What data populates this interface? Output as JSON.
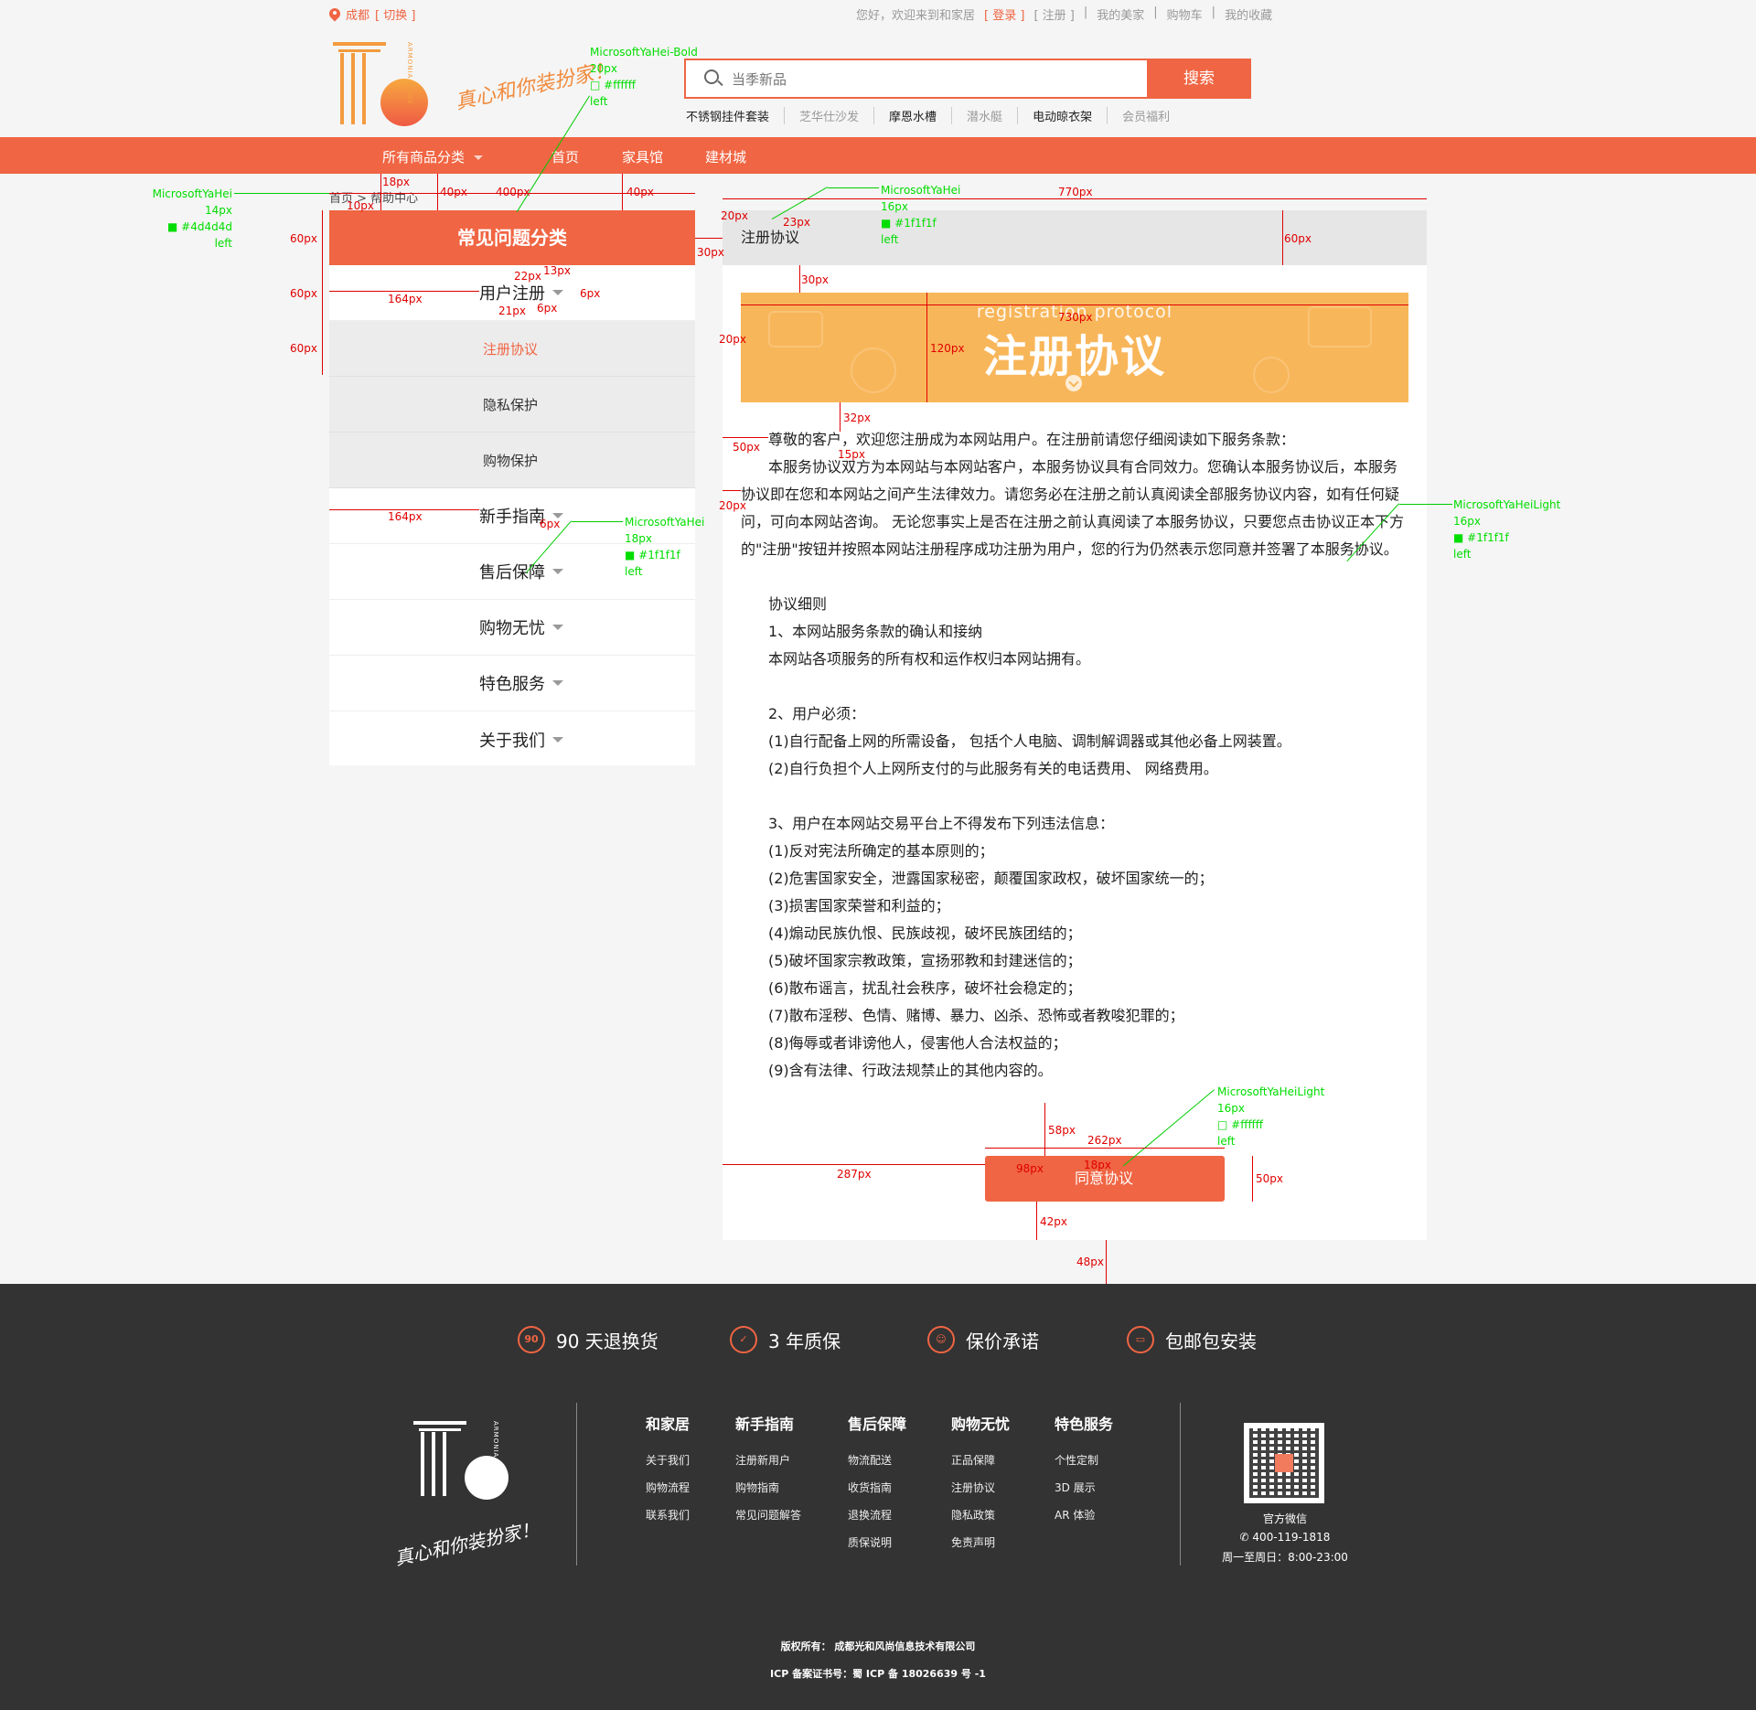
{
  "topbar": {
    "city": "成都",
    "switch": "[ 切换 ]",
    "welcome": "您好，欢迎来到和家居",
    "login": "[ 登录 ]",
    "register": "[ 注册 ]",
    "my_home": "我的美家",
    "cart": "购物车",
    "favorites": "我的收藏",
    "sep": "|"
  },
  "header": {
    "logo_side_text": "ARMONIA HOME",
    "slogan": "真心和你装扮家！",
    "search_placeholder": "当季新品",
    "search_button": "搜索",
    "hotwords": [
      "不锈钢挂件套装",
      "芝华仕沙发",
      "摩恩水槽",
      "潜水艇",
      "电动晾衣架",
      "会员福利"
    ]
  },
  "nav": {
    "all_categories": "所有商品分类",
    "items": [
      "首页",
      "家具馆",
      "建材城"
    ]
  },
  "breadcrumb": "首页 > 帮助中心",
  "sidebar": {
    "title": "常见问题分类",
    "group1": "用户注册",
    "sub": [
      "注册协议",
      "隐私保护",
      "购物保护"
    ],
    "groups": [
      "新手指南",
      "售后保障",
      "购物无忧",
      "特色服务",
      "关于我们"
    ]
  },
  "main": {
    "title": "注册协议",
    "banner_en": "registration protocol",
    "banner_cn": "注册协议",
    "paragraphs": [
      "尊敬的客户，欢迎您注册成为本网站用户。在注册前请您仔细阅读如下服务条款：",
      "本服务协议双方为本网站与本网站客户，本服务协议具有合同效力。您确认本服务协议后，本服务协议即在您和本网站之间产生法律效力。请您务必在注册之前认真阅读全部服务协议内容，如有任何疑问，可向本网站咨询。 无论您事实上是否在注册之前认真阅读了本服务协议，只要您点击协议正本下方的\"注册\"按钮并按照本网站注册程序成功注册为用户，您的行为仍然表示您同意并签署了本服务协议。"
    ],
    "lines": [
      "",
      "协议细则",
      "1、本网站服务条款的确认和接纳",
      "本网站各项服务的所有权和运作权归本网站拥有。",
      "",
      "2、用户必须：",
      "(1)自行配备上网的所需设备， 包括个人电脑、调制解调器或其他必备上网装置。",
      "(2)自行负担个人上网所支付的与此服务有关的电话费用、 网络费用。",
      "",
      "3、用户在本网站交易平台上不得发布下列违法信息：",
      "(1)反对宪法所确定的基本原则的；",
      "(2)危害国家安全，泄露国家秘密，颠覆国家政权，破坏国家统一的；",
      "(3)损害国家荣誉和利益的；",
      "(4)煽动民族仇恨、民族歧视，破坏民族团结的；",
      "(5)破坏国家宗教政策，宣扬邪教和封建迷信的；",
      "(6)散布谣言，扰乱社会秩序，破坏社会稳定的；",
      "(7)散布淫秽、色情、赌博、暴力、凶杀、恐怖或者教唆犯罪的；",
      "(8)侮辱或者诽谤他人，侵害他人合法权益的；",
      "(9)含有法律、行政法规禁止的其他内容的。"
    ],
    "agree_button": "同意协议"
  },
  "annotations": {
    "green": [
      "MicrosoftYaHei-Bold",
      "20px",
      "□ #ffffff",
      "left",
      "MicrosoftYaHei",
      "14px",
      "■ #4d4d4d",
      "left",
      "MicrosoftYaHei",
      "16px",
      "■ #1f1f1f",
      "left",
      "MicrosoftYaHei",
      "18px",
      "■ #1f1f1f",
      "left",
      "MicrosoftYaHeiLight",
      "16px",
      "■ #1f1f1f",
      "left",
      "MicrosoftYaHeiLight",
      "16px",
      "□ #ffffff",
      "left"
    ],
    "red": [
      "18px",
      "10px",
      "40px",
      "400px",
      "40px",
      "60px",
      "60px",
      "60px",
      "164px",
      "22px",
      "13px",
      "21px",
      "6px",
      "6px",
      "164px",
      "6px",
      "20px",
      "23px",
      "770px",
      "60px",
      "30px",
      "30px",
      "730px",
      "120px",
      "20px",
      "32px",
      "50px",
      "15px",
      "20px",
      "58px",
      "262px",
      "98px",
      "18px",
      "287px",
      "50px",
      "42px",
      "48px"
    ]
  },
  "footer": {
    "promises": [
      {
        "icon": "90",
        "label": "90 天退换货"
      },
      {
        "icon": "shield",
        "label": "3 年质保"
      },
      {
        "icon": "user",
        "label": "保价承诺"
      },
      {
        "icon": "truck",
        "label": "包邮包安装"
      }
    ],
    "logo_side_text": "ARMONIA HOME",
    "slogan": "真心和你装扮家！",
    "columns": [
      {
        "title": "和家居",
        "items": [
          "关于我们",
          "购物流程",
          "联系我们"
        ]
      },
      {
        "title": "新手指南",
        "items": [
          "注册新用户",
          "购物指南",
          "常见问题解答"
        ]
      },
      {
        "title": "售后保障",
        "items": [
          "物流配送",
          "收货指南",
          "退换流程",
          "质保说明"
        ]
      },
      {
        "title": "购物无忧",
        "items": [
          "正品保障",
          "注册协议",
          "隐私政策",
          "免责声明"
        ]
      },
      {
        "title": "特色服务",
        "items": [
          "个性定制",
          "3D 展示",
          "AR 体验"
        ]
      }
    ],
    "wechat": "官方微信",
    "phone": "400-119-1818",
    "hours": "周一至周日：8:00-23:00",
    "copyright": "版权所有： 成都光和风尚信息技术有限公司",
    "icp": "ICP 备案证书号：蜀 ICP 备 18026639 号 -1"
  },
  "colors": {
    "accent": "#f06543",
    "banner": "#f8b65a",
    "footer_bg": "#333333",
    "text": "#1f1f1f",
    "annotation_green": "#00dd00",
    "annotation_red": "#e00000"
  }
}
